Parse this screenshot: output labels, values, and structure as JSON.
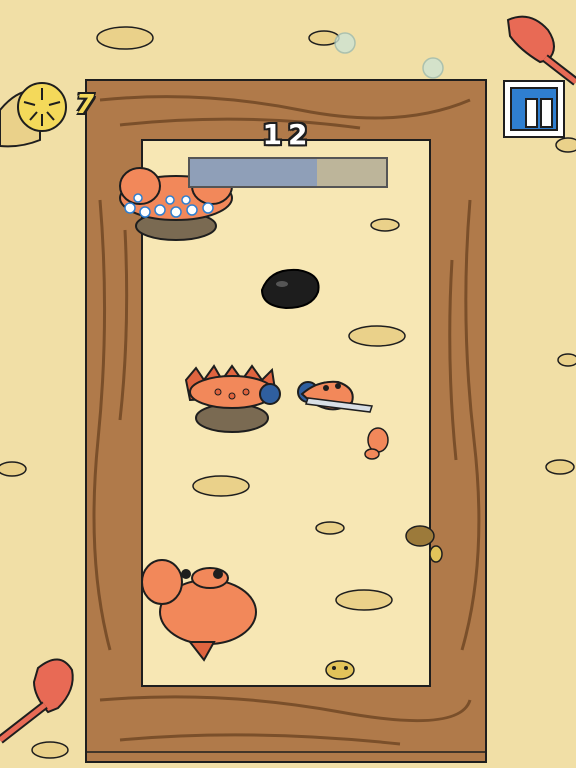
{
  "hud": {
    "score": "12",
    "coins": "7",
    "pause_icon": "pause-icon",
    "coin_icon": "sand-dollar-icon",
    "wave_progress": 0.65
  },
  "colors": {
    "sand": "#f1dfa6",
    "arena": "#f7e7b4",
    "wood": "#b07a4a",
    "wood_dark": "#7a4f2a",
    "crab": "#f2885a",
    "pause_blue": "#2f7fd0"
  },
  "entities": {
    "enemy_crabs": [
      "bubble-crab",
      "spiky-crab",
      "spiky-crab",
      "big-crab",
      "small-crab",
      "yellow-crab",
      "yellow-crab"
    ],
    "player": "player-crab-with-sword",
    "obstacle": "black-rock"
  }
}
